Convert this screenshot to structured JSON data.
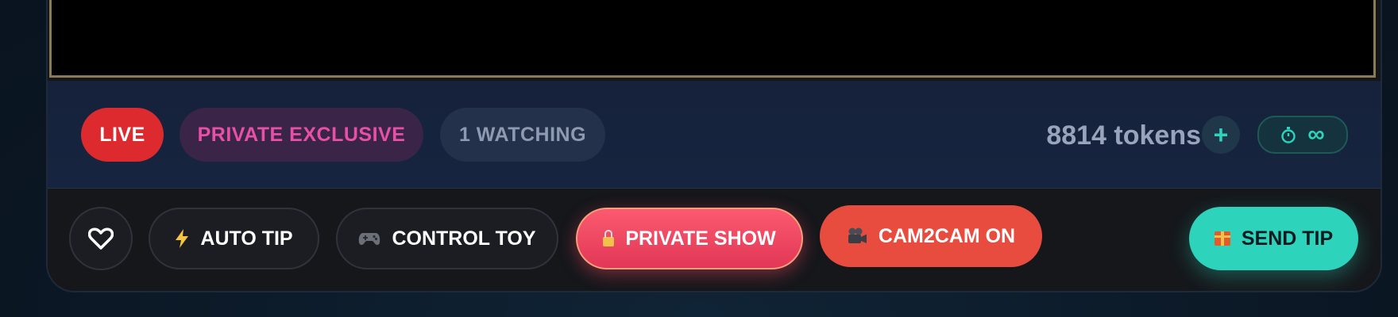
{
  "status": {
    "live_label": "LIVE",
    "private_label": "PRIVATE EXCLUSIVE",
    "watching_label": "1 WATCHING",
    "tokens_label": "8814 tokens",
    "add_tokens_label": "+",
    "timer_icon": "stopwatch-icon",
    "timer_value": "∞"
  },
  "actions": {
    "heart_icon": "heart-icon",
    "auto_tip_icon": "lightning-icon",
    "auto_tip_label": "AUTO TIP",
    "control_toy_icon": "gamepad-icon",
    "control_toy_label": "CONTROL TOY",
    "private_show_icon": "lock-icon",
    "private_show_label": "PRIVATE SHOW",
    "cam2cam_icon": "video-camera-icon",
    "cam2cam_label": "CAM2CAM ON",
    "send_tip_icon": "gift-icon",
    "send_tip_label": "SEND TIP"
  },
  "colors": {
    "live": "#dc2a2f",
    "private_text": "#e84fa6",
    "accent_teal": "#2ed3bc",
    "private_show": "#f0465a",
    "cam2cam": "#e84c3f"
  }
}
